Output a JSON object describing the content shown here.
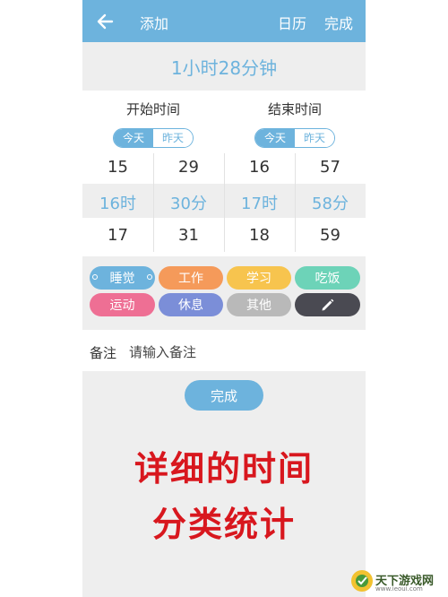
{
  "header": {
    "title": "添加",
    "calendar_label": "日历",
    "done_label": "完成"
  },
  "duration": "1小时28分钟",
  "start": {
    "label": "开始时间",
    "toggle": [
      "今天",
      "昨天"
    ],
    "hours": [
      "15",
      "16时",
      "17"
    ],
    "minutes": [
      "29",
      "30分",
      "31"
    ]
  },
  "end": {
    "label": "结束时间",
    "toggle": [
      "今天",
      "昨天"
    ],
    "hours": [
      "16",
      "17时",
      "18"
    ],
    "minutes": [
      "57",
      "58分",
      "59"
    ]
  },
  "categories": [
    {
      "label": "睡觉",
      "color": "#6db3dd"
    },
    {
      "label": "工作",
      "color": "#f59a5a"
    },
    {
      "label": "学习",
      "color": "#f7c44e"
    },
    {
      "label": "吃饭",
      "color": "#6dd3b8"
    },
    {
      "label": "运动",
      "color": "#ee6f94"
    },
    {
      "label": "休息",
      "color": "#7b8ed8"
    },
    {
      "label": "其他",
      "color": "#b9b9b9"
    },
    {
      "label": "",
      "color": "#4a4a52"
    }
  ],
  "note": {
    "label": "备注",
    "placeholder": "请输入备注"
  },
  "bottom_done_label": "完成",
  "promo": {
    "line1": "详细的时间",
    "line2": "分类统计"
  },
  "watermark": {
    "text": "天下游戏网",
    "sub": "www.ieoui.com"
  }
}
